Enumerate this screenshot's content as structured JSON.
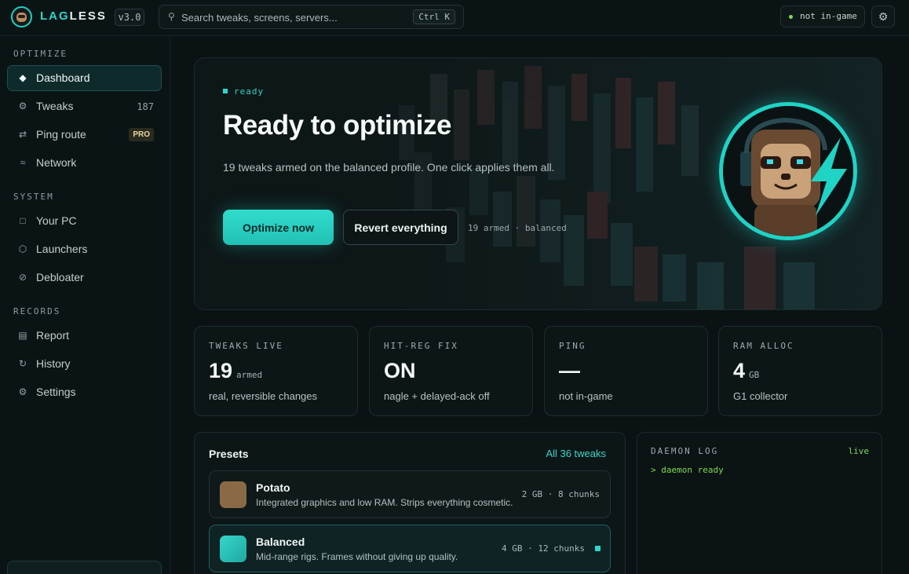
{
  "app": {
    "brand_part1": "LAG",
    "brand_part2": "LESS",
    "version": "v3.0"
  },
  "search": {
    "placeholder": "Search tweaks, screens, servers...",
    "shortcut": "Ctrl K"
  },
  "status": {
    "label": "not in-game"
  },
  "sidebar": {
    "sections": [
      {
        "label": "OPTIMIZE",
        "items": [
          {
            "label": "Dashboard",
            "icon": "diamond-icon",
            "active": true
          },
          {
            "label": "Tweaks",
            "icon": "gear-icon",
            "count": "187"
          },
          {
            "label": "Ping route",
            "icon": "route-arrows-icon",
            "badge": "PRO"
          },
          {
            "label": "Network",
            "icon": "waves-icon"
          }
        ]
      },
      {
        "label": "SYSTEM",
        "items": [
          {
            "label": "Your PC",
            "icon": "square-icon"
          },
          {
            "label": "Launchers",
            "icon": "hexagon-icon"
          },
          {
            "label": "Debloater",
            "icon": "slash-circle-icon"
          }
        ]
      },
      {
        "label": "RECORDS",
        "items": [
          {
            "label": "Report",
            "icon": "list-icon"
          },
          {
            "label": "History",
            "icon": "refresh-icon"
          },
          {
            "label": "Settings",
            "icon": "gear-icon"
          }
        ]
      }
    ]
  },
  "hero": {
    "tag": "ready",
    "title": "Ready to optimize",
    "description": "19 tweaks armed on the balanced profile. One click applies them all.",
    "primary_button": "Optimize now",
    "secondary_button": "Revert everything",
    "meta": "19 armed · balanced"
  },
  "stats": [
    {
      "label": "TWEAKS LIVE",
      "value": "19",
      "unit": "armed",
      "sub": "real, reversible changes"
    },
    {
      "label": "HIT-REG FIX",
      "value": "ON",
      "unit": "",
      "sub": "nagle + delayed-ack off"
    },
    {
      "label": "PING",
      "value": "—",
      "unit": "",
      "sub": "not in-game"
    },
    {
      "label": "RAM ALLOC",
      "value": "4",
      "unit": "GB",
      "sub": "G1 collector"
    }
  ],
  "presets": {
    "title": "Presets",
    "link": "All 36 tweaks",
    "items": [
      {
        "name": "Potato",
        "desc": "Integrated graphics and low RAM. Strips everything cosmetic.",
        "meta": "2 GB · 8 chunks",
        "color": "#8a6a46",
        "selected": false
      },
      {
        "name": "Balanced",
        "desc": "Mid-range rigs. Frames without giving up quality.",
        "meta": "4 GB · 12 chunks",
        "color": "#2ec4ba",
        "selected": true
      }
    ]
  },
  "log": {
    "title": "DAEMON LOG",
    "live": "live",
    "lines": [
      "> daemon ready"
    ]
  },
  "colors": {
    "accent": "#2fd6c8",
    "background": "#0a1213",
    "live_green": "#7ed957"
  }
}
